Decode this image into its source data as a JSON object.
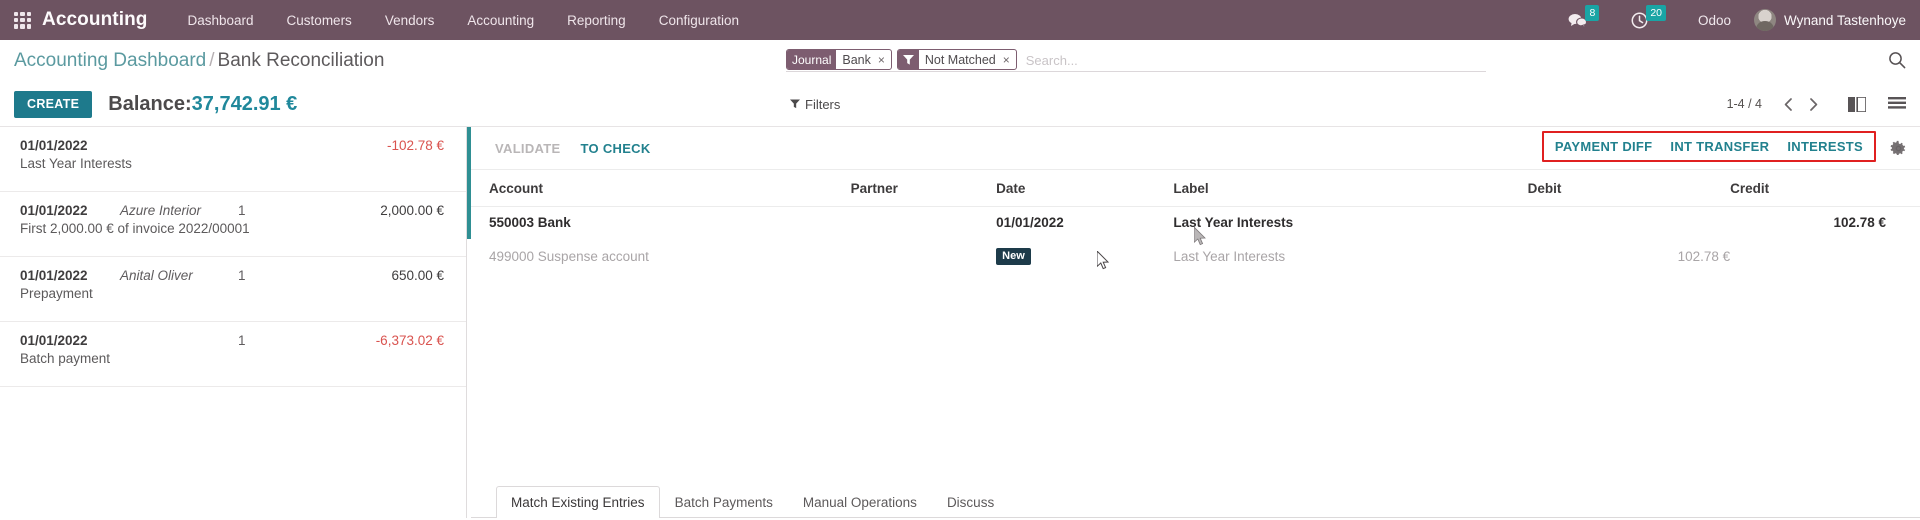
{
  "navbar": {
    "apps_icon": "apps-grid-icon",
    "brand": "Accounting",
    "menu": [
      {
        "label": "Dashboard"
      },
      {
        "label": "Customers"
      },
      {
        "label": "Vendors"
      },
      {
        "label": "Accounting"
      },
      {
        "label": "Reporting"
      },
      {
        "label": "Configuration"
      }
    ],
    "messages_icon": "chat-icon",
    "messages_count": "8",
    "activities_icon": "clock-icon",
    "activities_count": "20",
    "database": "Odoo",
    "user": "Wynand Tastenhoye",
    "accent_teal": "#19a5a5",
    "bar_color": "#6d5361"
  },
  "breadcrumb": {
    "parent": "Accounting Dashboard",
    "separator": "/",
    "current": "Bank Reconciliation"
  },
  "search": {
    "facets": [
      {
        "key": "Journal",
        "value": "Bank",
        "remove": "×",
        "icon": ""
      },
      {
        "key": "",
        "value": "Not Matched",
        "remove": "×",
        "icon": "filter-funnel-icon"
      }
    ],
    "placeholder": "Search...",
    "search_icon": "search-icon"
  },
  "toolbar": {
    "create_label": "CREATE",
    "balance_label": "Balance:",
    "balance_value": "37,742.91 €",
    "filters_label": "Filters",
    "filters_icon": "funnel-icon",
    "pager_text": "1-4 / 4",
    "prev_icon": "chevron-left-icon",
    "next_icon": "chevron-right-icon",
    "view_kanban_icon": "kanban-view-icon",
    "view_list_icon": "list-view-icon"
  },
  "statement_lines": [
    {
      "date": "01/01/2022",
      "partner": "",
      "count": "",
      "amount": "-102.78 €",
      "amount_sign": "neg",
      "label": "Last Year Interests"
    },
    {
      "date": "01/01/2022",
      "partner": "Azure Interior",
      "count": "1",
      "amount": "2,000.00 €",
      "amount_sign": "pos",
      "label": "First 2,000.00 € of invoice 2022/00001"
    },
    {
      "date": "01/01/2022",
      "partner": "Anital Oliver",
      "count": "1",
      "amount": "650.00 €",
      "amount_sign": "pos",
      "label": "Prepayment"
    },
    {
      "date": "01/01/2022",
      "partner": "",
      "count": "1",
      "amount": "-6,373.02 €",
      "amount_sign": "neg",
      "label": "Batch payment"
    }
  ],
  "reconcile": {
    "validate_label": "VALIDATE",
    "to_check_label": "TO CHECK",
    "payment_diff_label": "PAYMENT DIFF",
    "int_transfer_label": "INT TRANSFER",
    "interests_label": "INTERESTS",
    "gear_icon": "gear-icon",
    "highlight_color": "#e02020",
    "columns": {
      "account": "Account",
      "partner": "Partner",
      "date": "Date",
      "label": "Label",
      "debit": "Debit",
      "credit": "Credit"
    },
    "rows": [
      {
        "account": "550003 Bank",
        "partner": "",
        "date": "01/01/2022",
        "tag": "",
        "label": "Last Year Interests",
        "debit": "",
        "credit": "102.78 €",
        "style": "main"
      },
      {
        "account": "499000 Suspense account",
        "partner": "",
        "date": "",
        "tag": "New",
        "label": "Last Year Interests",
        "debit": "102.78 €",
        "credit": "",
        "style": "sub"
      }
    ],
    "tabs": [
      {
        "label": "Match Existing Entries",
        "active": true
      },
      {
        "label": "Batch Payments",
        "active": false
      },
      {
        "label": "Manual Operations",
        "active": false
      },
      {
        "label": "Discuss",
        "active": false
      }
    ]
  }
}
